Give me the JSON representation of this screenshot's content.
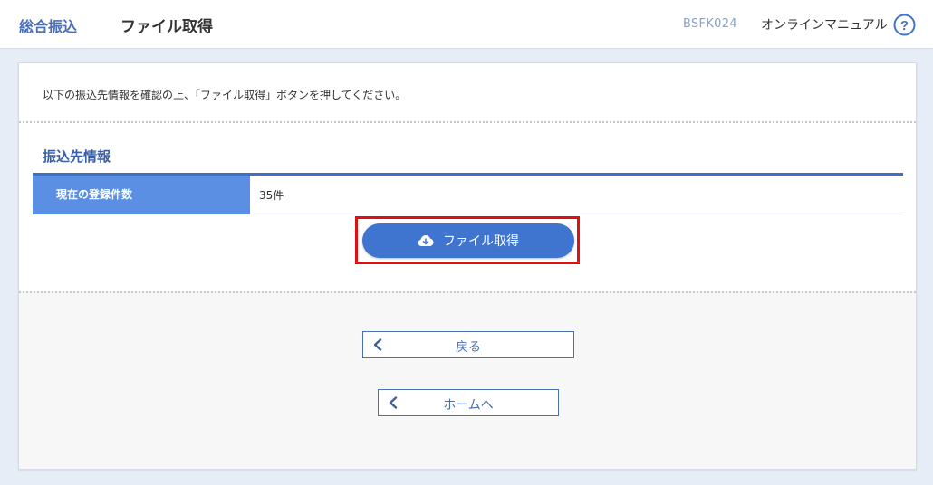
{
  "header": {
    "breadcrumb": "総合振込",
    "title": "ファイル取得",
    "screen_id": "BSFK024",
    "manual_label": "オンラインマニュアル",
    "help_glyph": "?"
  },
  "main": {
    "instruction": "以下の振込先情報を確認の上、「ファイル取得」ボタンを押してください。",
    "section_title": "振込先情報",
    "table": {
      "header": "現在の登録件数",
      "value": "35件"
    },
    "primary_button": {
      "icon": "cloud-download-icon",
      "label": "ファイル取得"
    }
  },
  "footer": {
    "back_label": "戻る",
    "home_label": "ホームへ"
  },
  "colors": {
    "accent": "#3f74cf",
    "table_header": "#5b8fe3",
    "highlight": "#e01010",
    "background": "#e6edf7"
  }
}
